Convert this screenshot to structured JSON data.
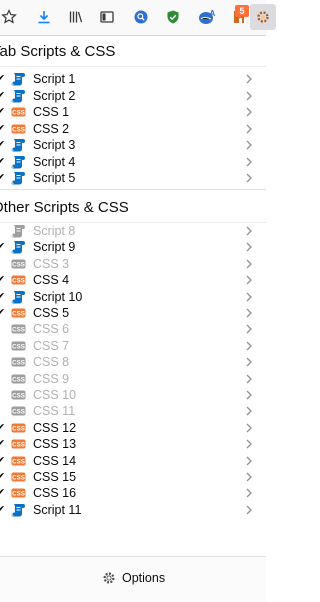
{
  "colors": {
    "script_blue": "#0a72c6",
    "css_orange": "#ef7a35",
    "disabled_grey": "#9e9ea1",
    "badge": "#ff7139"
  },
  "toolbar": {
    "icons": [
      "star-icon",
      "download-icon",
      "library-icon",
      "sidebar-icon",
      "search-engine-icon",
      "shield-icon",
      "translate-icon",
      "puzzle-extension-icon",
      "gear-icon"
    ],
    "badge_count": "5"
  },
  "tab_section": {
    "title": "Tab Scripts & CSS",
    "items": [
      {
        "label": "Script 1",
        "type": "script",
        "enabled": true
      },
      {
        "label": "Script 2",
        "type": "script",
        "enabled": true
      },
      {
        "label": "CSS 1",
        "type": "css",
        "enabled": true
      },
      {
        "label": "CSS 2",
        "type": "css",
        "enabled": true
      },
      {
        "label": "Script 3",
        "type": "script",
        "enabled": true
      },
      {
        "label": "Script 4",
        "type": "script",
        "enabled": true
      },
      {
        "label": "Script 5",
        "type": "script",
        "enabled": true
      }
    ]
  },
  "other_section": {
    "title": "Other Scripts & CSS",
    "items": [
      {
        "label": "Script 8",
        "type": "script",
        "enabled": false
      },
      {
        "label": "Script 9",
        "type": "script",
        "enabled": true
      },
      {
        "label": "CSS 3",
        "type": "css",
        "enabled": false
      },
      {
        "label": "CSS 4",
        "type": "css",
        "enabled": true
      },
      {
        "label": "Script 10",
        "type": "script",
        "enabled": true
      },
      {
        "label": "CSS 5",
        "type": "css",
        "enabled": true
      },
      {
        "label": "CSS 6",
        "type": "css",
        "enabled": false
      },
      {
        "label": "CSS 7",
        "type": "css",
        "enabled": false
      },
      {
        "label": "CSS 8",
        "type": "css",
        "enabled": false
      },
      {
        "label": "CSS 9",
        "type": "css",
        "enabled": false
      },
      {
        "label": "CSS 10",
        "type": "css",
        "enabled": false
      },
      {
        "label": "CSS 11",
        "type": "css",
        "enabled": false
      },
      {
        "label": "CSS 12",
        "type": "css",
        "enabled": true
      },
      {
        "label": "CSS 13",
        "type": "css",
        "enabled": true
      },
      {
        "label": "CSS 14",
        "type": "css",
        "enabled": true
      },
      {
        "label": "CSS 15",
        "type": "css",
        "enabled": true
      },
      {
        "label": "CSS 16",
        "type": "css",
        "enabled": true
      },
      {
        "label": "Script 11",
        "type": "script",
        "enabled": true
      }
    ]
  },
  "footer": {
    "options_label": "Options"
  }
}
